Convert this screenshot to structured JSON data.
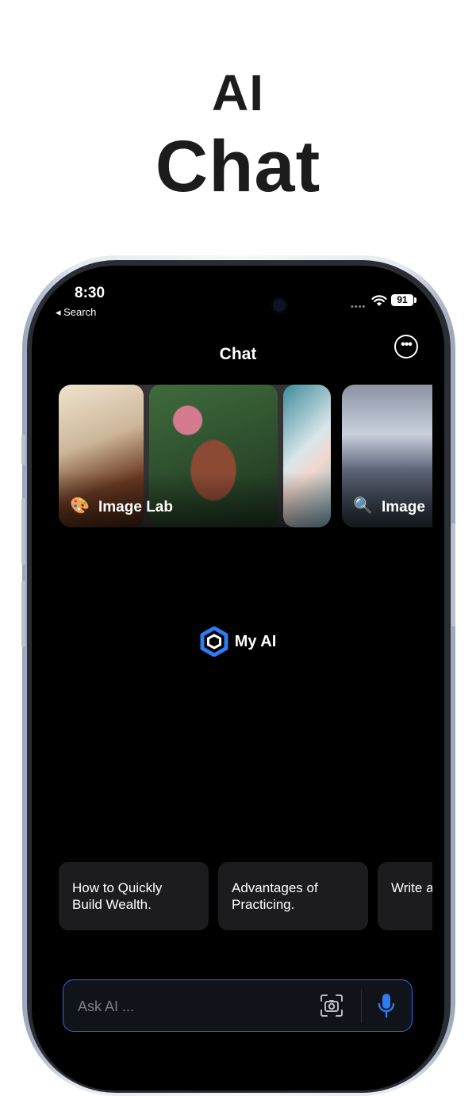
{
  "promo": {
    "line1": "AI",
    "line2": "Chat"
  },
  "status_bar": {
    "time": "8:30",
    "back_label": "◂ Search",
    "battery": "91"
  },
  "header": {
    "title": "Chat",
    "more_icon": "ellipsis-circle-icon"
  },
  "cards": [
    {
      "label": "Image Lab",
      "icon": "palette-icon",
      "glyph": "🎨"
    },
    {
      "label": "Image",
      "icon": "image-search-icon",
      "glyph": "🔍"
    }
  ],
  "my_ai": {
    "label": "My AI",
    "icon": "hexagon-logo-icon"
  },
  "suggestions": [
    {
      "text": "How to Quickly Build Wealth."
    },
    {
      "text": "Advantages of Practicing."
    },
    {
      "text": "Write a Resignation"
    }
  ],
  "input": {
    "placeholder": "Ask AI ...",
    "camera_icon": "camera-scan-icon",
    "mic_icon": "microphone-icon"
  },
  "colors": {
    "accent": "#2d6cdf",
    "background": "#000000",
    "chip": "#1c1c1e"
  }
}
